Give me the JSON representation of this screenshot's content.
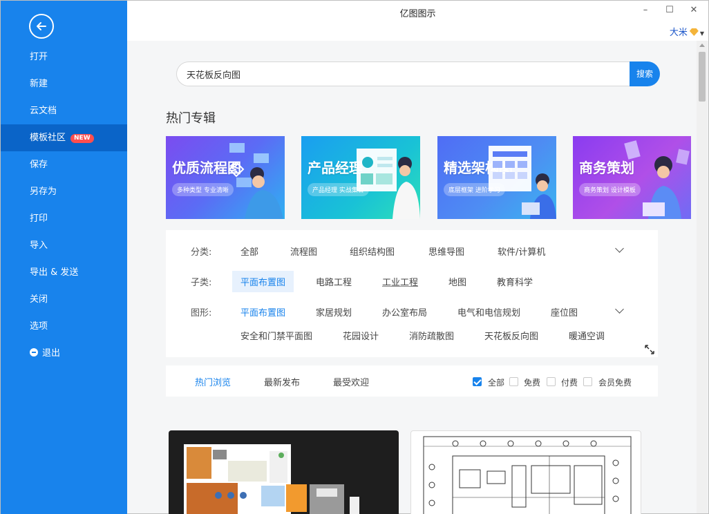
{
  "app": {
    "title": "亿图图示"
  },
  "window": {
    "minimize": "–",
    "maximize": "☐",
    "close": "✕"
  },
  "user": {
    "name": "大米"
  },
  "sidebar": {
    "items": [
      {
        "label": "打开"
      },
      {
        "label": "新建"
      },
      {
        "label": "云文档"
      },
      {
        "label": "模板社区",
        "badge": "NEW"
      },
      {
        "label": "保存"
      },
      {
        "label": "另存为"
      },
      {
        "label": "打印"
      },
      {
        "label": "导入"
      },
      {
        "label": "导出 & 发送"
      },
      {
        "label": "关闭"
      },
      {
        "label": "选项"
      },
      {
        "label": "退出"
      }
    ]
  },
  "search": {
    "value": "天花板反向图",
    "button": "搜索"
  },
  "hot": {
    "title": "热门专辑",
    "banners": [
      {
        "title": "优质流程图",
        "sub": "多种类型 专业清晰"
      },
      {
        "title": "产品经理",
        "sub": "产品经理 实战集合"
      },
      {
        "title": "精选架构图",
        "sub": "底层框架 进阶学习"
      },
      {
        "title": "商务策划",
        "sub": "商务策划 设计模板"
      }
    ]
  },
  "filters": {
    "category_label": "分类:",
    "categories": [
      "全部",
      "流程图",
      "组织结构图",
      "思维导图",
      "软件/计算机"
    ],
    "subcategory_label": "子类:",
    "subcategories": [
      "平面布置图",
      "电路工程",
      "工业工程",
      "地图",
      "教育科学"
    ],
    "shape_label": "图形:",
    "shapes_row1": [
      "平面布置图",
      "家居规划",
      "办公室布局",
      "电气和电信规划",
      "座位图"
    ],
    "shapes_row2": [
      "安全和门禁平面图",
      "花园设计",
      "消防疏散图",
      "天花板反向图",
      "暖通空调"
    ]
  },
  "sort": {
    "tabs": [
      "热门浏览",
      "最新发布",
      "最受欢迎"
    ],
    "checks": [
      {
        "label": "全部",
        "checked": true
      },
      {
        "label": "免费",
        "checked": false
      },
      {
        "label": "付费",
        "checked": false
      },
      {
        "label": "会员免费",
        "checked": false
      }
    ]
  },
  "colors": {
    "primary": "#1883ec",
    "sidebar_active": "#0a64c8",
    "badge": "#ff4e4e"
  }
}
